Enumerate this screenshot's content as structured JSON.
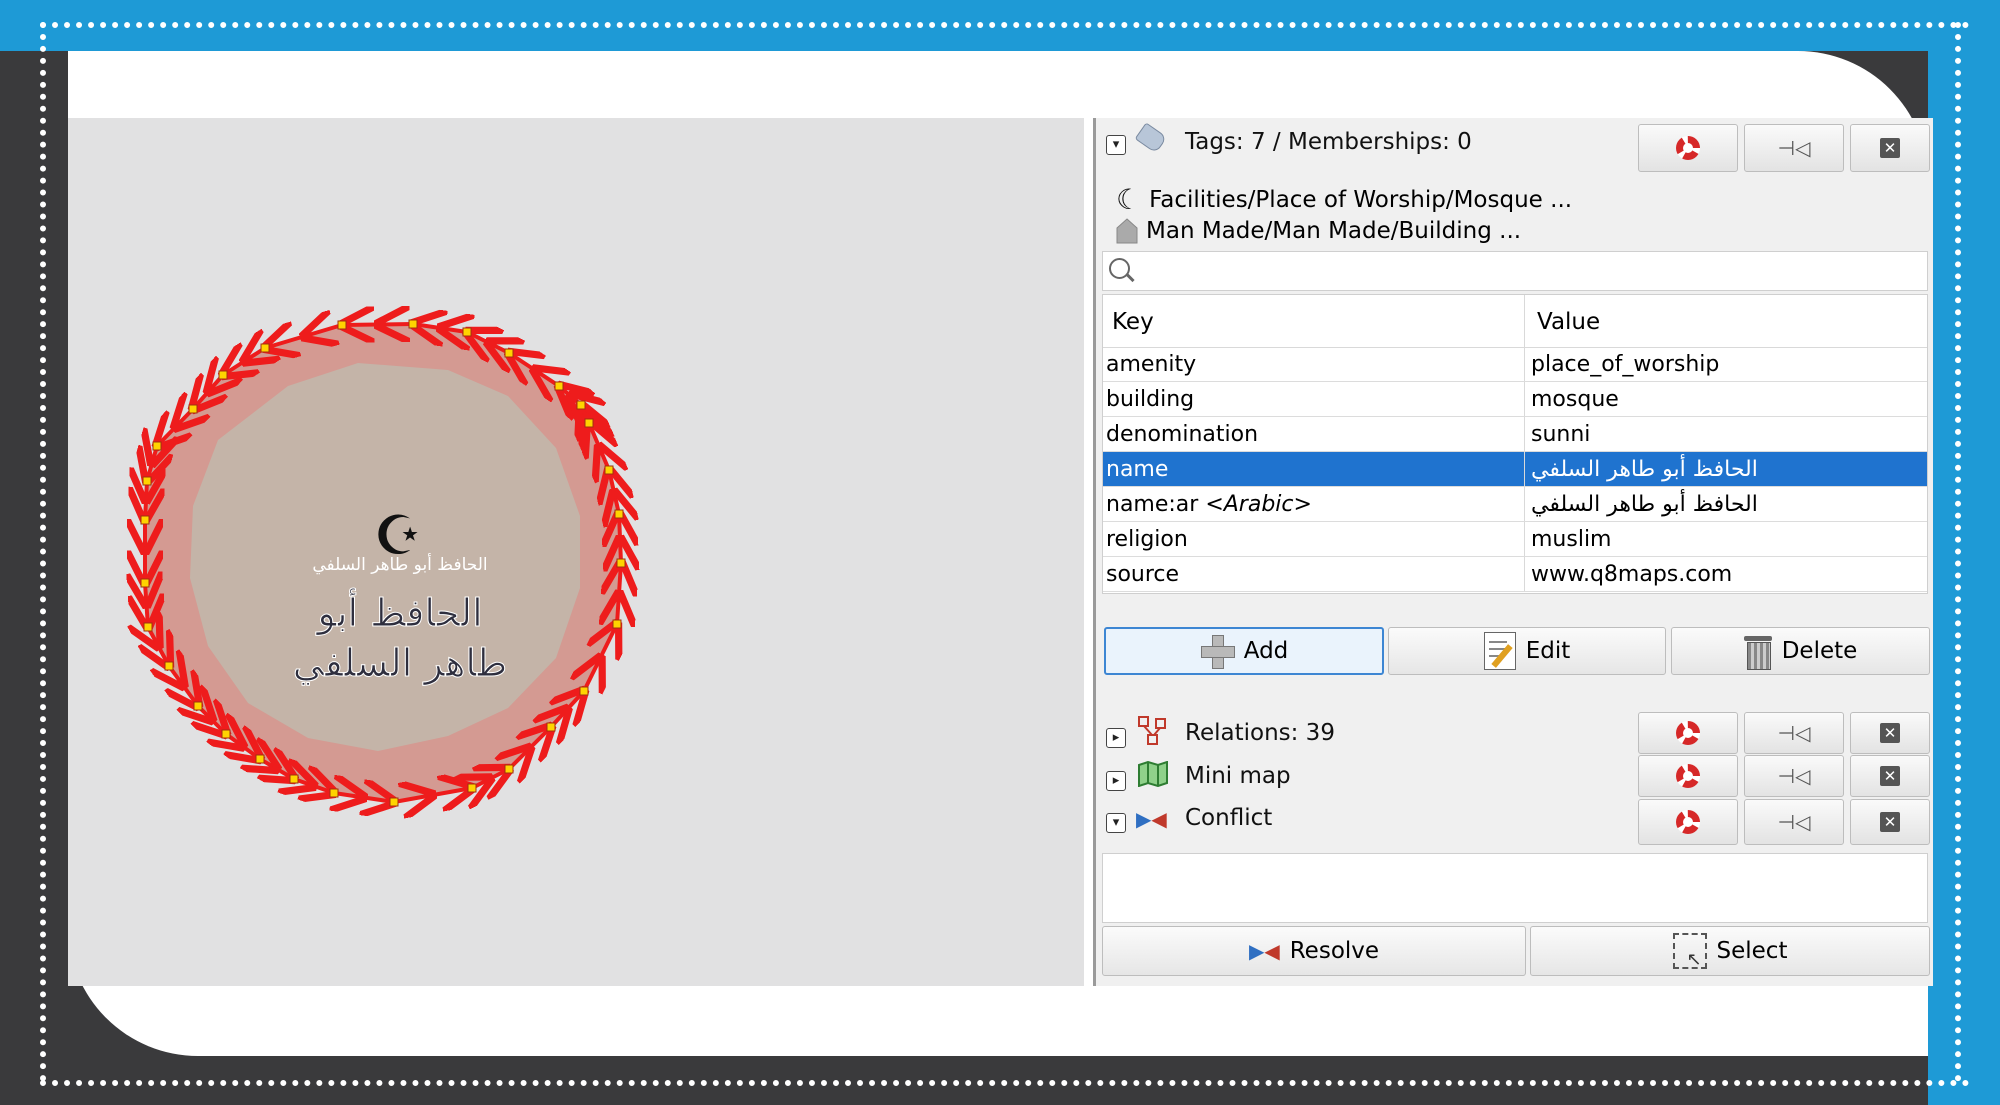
{
  "tags_panel": {
    "title": "Tags: 7 / Memberships: 0",
    "presets": [
      {
        "icon": "crescent-icon",
        "label": "Facilities/Place of Worship/Mosque ..."
      },
      {
        "icon": "house-icon",
        "label": "Man Made/Man Made/Building ..."
      }
    ],
    "search_placeholder": "",
    "columns": {
      "key": "Key",
      "value": "Value"
    },
    "rows": [
      {
        "key": "amenity",
        "key_suffix": "",
        "value": "place_of_worship"
      },
      {
        "key": "building",
        "key_suffix": "",
        "value": "mosque"
      },
      {
        "key": "denomination",
        "key_suffix": "",
        "value": "sunni"
      },
      {
        "key": "name",
        "key_suffix": "",
        "value": "الحافظ أبو طاهر السلفي"
      },
      {
        "key": "name:ar ",
        "key_suffix": "<Arabic>",
        "value": "الحافظ أبو طاهر السلفي"
      },
      {
        "key": "religion",
        "key_suffix": "",
        "value": "muslim"
      },
      {
        "key": "source",
        "key_suffix": "",
        "value": "www.q8maps.com"
      }
    ],
    "selected_row": "name",
    "buttons": {
      "add": "Add",
      "edit": "Edit",
      "delete": "Delete"
    }
  },
  "relations_panel": {
    "title": "Relations: 39"
  },
  "minimap_panel": {
    "title": "Mini map"
  },
  "conflict_panel": {
    "title": "Conflict",
    "buttons": {
      "resolve": "Resolve",
      "select": "Select"
    }
  },
  "map": {
    "small_label": "الحافظ أبو طاهر السلفي",
    "label_line1": "الحافظ أبو",
    "label_line2": "طاهر السلفي",
    "symbol": "☪"
  },
  "colors": {
    "frame_blue": "#1e9ad6",
    "frame_dark": "#3a3a3c",
    "selection": "#1f73cf",
    "way_stroke": "#ee1c1c",
    "area_fill": "#d49a92",
    "building_fill": "#c4b4a8",
    "node_fill": "#ffd400"
  }
}
